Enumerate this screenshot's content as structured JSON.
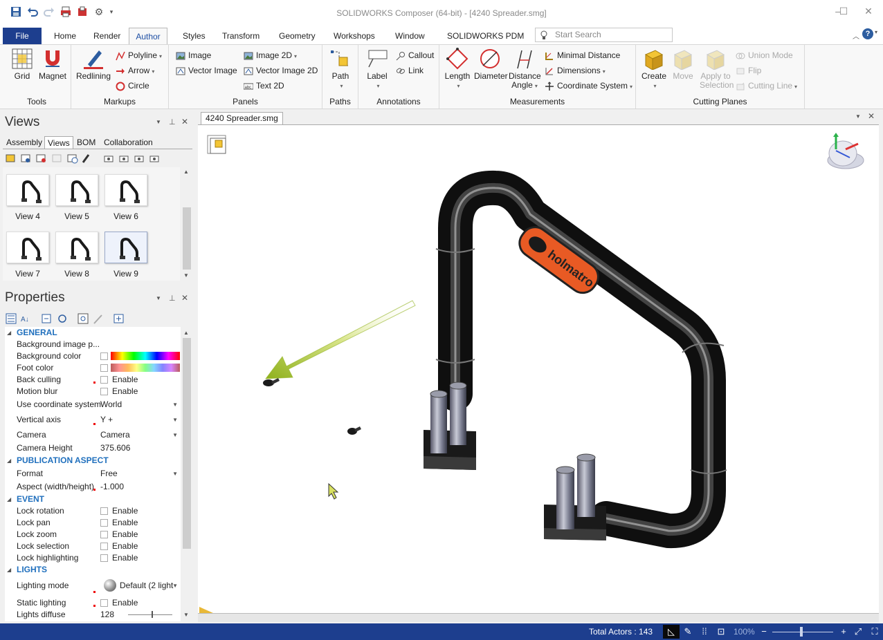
{
  "window": {
    "title": "SOLIDWORKS Composer (64-bit) - [4240 Spreader.smg]"
  },
  "menu": {
    "file": "File",
    "tabs": [
      "Home",
      "Render",
      "Author",
      "Styles",
      "Transform",
      "Geometry",
      "Workshops",
      "Window",
      "SOLIDWORKS PDM"
    ],
    "active": "Author",
    "search_placeholder": "Start Search"
  },
  "ribbon": {
    "tools": {
      "label": "Tools",
      "grid": "Grid",
      "magnet": "Magnet"
    },
    "markups": {
      "label": "Markups",
      "redlining": "Redlining",
      "polyline": "Polyline",
      "arrow": "Arrow",
      "circle": "Circle"
    },
    "panels": {
      "label": "Panels",
      "image": "Image",
      "vector_image": "Vector Image",
      "image2d": "Image 2D",
      "vector_image2d": "Vector Image 2D",
      "text2d": "Text 2D"
    },
    "paths": {
      "label": "Paths",
      "path": "Path"
    },
    "annotations": {
      "label": "Annotations",
      "label_btn": "Label",
      "callout": "Callout",
      "link": "Link"
    },
    "measurements": {
      "label": "Measurements",
      "length": "Length",
      "diameter": "Diameter",
      "distance": "Distance",
      "angle": "Angle",
      "minimal_distance": "Minimal Distance",
      "dimensions": "Dimensions",
      "coordinate_system": "Coordinate System"
    },
    "cutting": {
      "label": "Cutting Planes",
      "create": "Create",
      "move": "Move",
      "apply_to": "Apply to",
      "selection": "Selection",
      "union_mode": "Union Mode",
      "flip": "Flip",
      "cutting_line": "Cutting Line"
    }
  },
  "views_panel": {
    "title": "Views",
    "tabs": [
      "Assembly",
      "Views",
      "BOM",
      "Collaboration"
    ],
    "active_tab": "Views",
    "thumbnails": [
      "View 4",
      "View 5",
      "View 6",
      "View 7",
      "View 8",
      "View 9"
    ]
  },
  "properties": {
    "title": "Properties",
    "general": "GENERAL",
    "bg_image": "Background image p...",
    "bg_color": "Background color",
    "foot_color": "Foot color",
    "back_culling": "Back culling",
    "motion_blur": "Motion blur",
    "use_coord": "Use coordinate system",
    "use_coord_val": "World",
    "vertical_axis": "Vertical axis",
    "vertical_axis_val": "Y +",
    "camera": "Camera",
    "camera_val": "Camera",
    "camera_height": "Camera Height",
    "camera_height_val": "375.606",
    "publication": "PUBLICATION ASPECT",
    "format": "Format",
    "format_val": "Free",
    "aspect": "Aspect (width/height)",
    "aspect_val": "-1.000",
    "event": "EVENT",
    "lock_rotation": "Lock rotation",
    "lock_pan": "Lock pan",
    "lock_zoom": "Lock zoom",
    "lock_selection": "Lock selection",
    "lock_highlighting": "Lock highlighting",
    "lights": "LIGHTS",
    "lighting_mode": "Lighting mode",
    "lighting_mode_val": "Default (2 light",
    "static_lighting": "Static lighting",
    "lights_diffuse": "Lights diffuse",
    "lights_diffuse_val": "128",
    "enable": "Enable"
  },
  "document": {
    "tab": "4240 Spreader.smg",
    "brand_text": "holmatro"
  },
  "status": {
    "total_actors": "Total Actors : 143",
    "zoom": "100%"
  }
}
